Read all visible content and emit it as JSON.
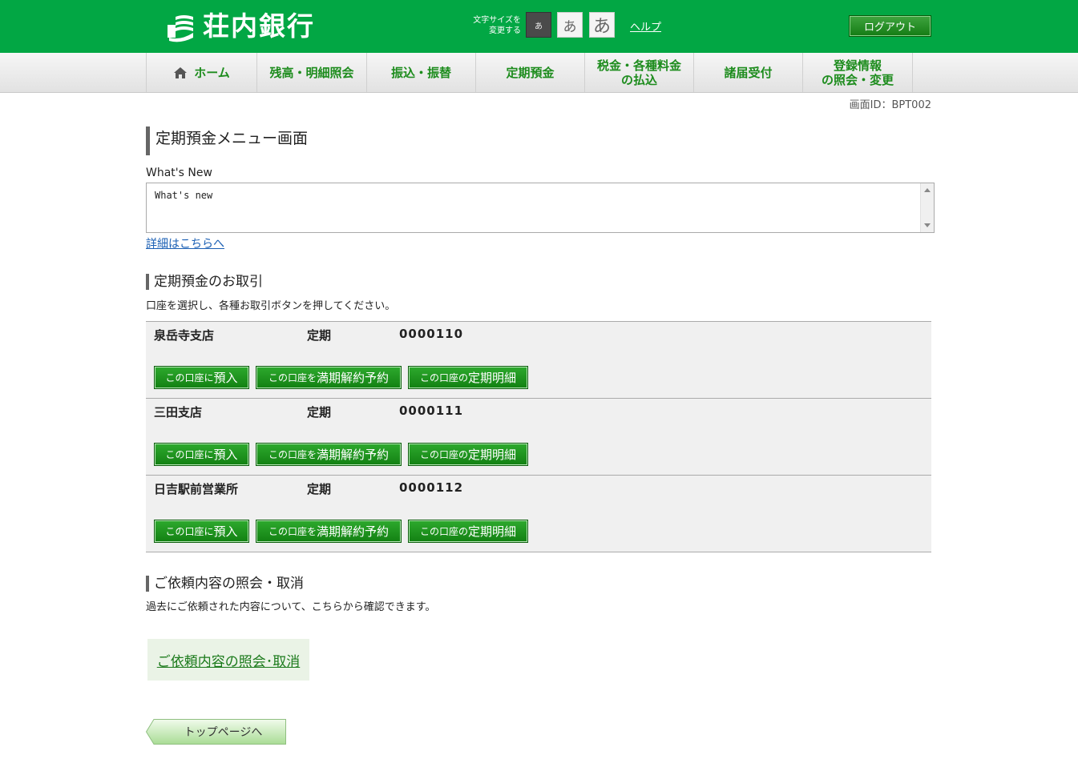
{
  "header": {
    "bank_name": "荘内銀行",
    "font_size_label": "文字サイズを\n変更する",
    "font_size_buttons": [
      "あ",
      "あ",
      "あ"
    ],
    "help": "ヘルプ",
    "logout": "ログアウト",
    "colors": {
      "brand_green": "#02a744",
      "nav_text": "#1d8c1d"
    }
  },
  "nav": {
    "items": [
      {
        "label": "ホーム",
        "icon": "home-icon"
      },
      {
        "label": "残高・明細照会"
      },
      {
        "label": "振込・振替"
      },
      {
        "label": "定期預金"
      },
      {
        "label": "税金・各種料金\nの払込"
      },
      {
        "label": "諸届受付"
      },
      {
        "label": "登録情報\nの照会・変更"
      }
    ]
  },
  "screen_id": "画面ID：BPT002",
  "page_title": "定期預金メニュー画面",
  "whats_new": {
    "label": "What's New",
    "content": "What's new",
    "detail_link": "詳細はこちらへ"
  },
  "deposit_section": {
    "title": "定期預金のお取引",
    "description": "口座を選択し、各種お取引ボタンを押してください。",
    "accounts": [
      {
        "branch": "泉岳寺支店",
        "type": "定期",
        "number": "0000110"
      },
      {
        "branch": "三田支店",
        "type": "定期",
        "number": "0000111"
      },
      {
        "branch": "日吉駅前営業所",
        "type": "定期",
        "number": "0000112"
      }
    ],
    "buttons": {
      "deposit_prefix": "この口座に",
      "deposit_main": "預入",
      "cancel_prefix": "この口座を",
      "cancel_main": "満期解約予約",
      "detail_prefix": "この口座の",
      "detail_main": "定期明細"
    }
  },
  "request_section": {
    "title": "ご依頼内容の照会・取消",
    "description": "過去にご依頼された内容について、こちらから確認できます。",
    "link": "ご依頼内容の照会･取消"
  },
  "top_page_button": "トップページへ"
}
